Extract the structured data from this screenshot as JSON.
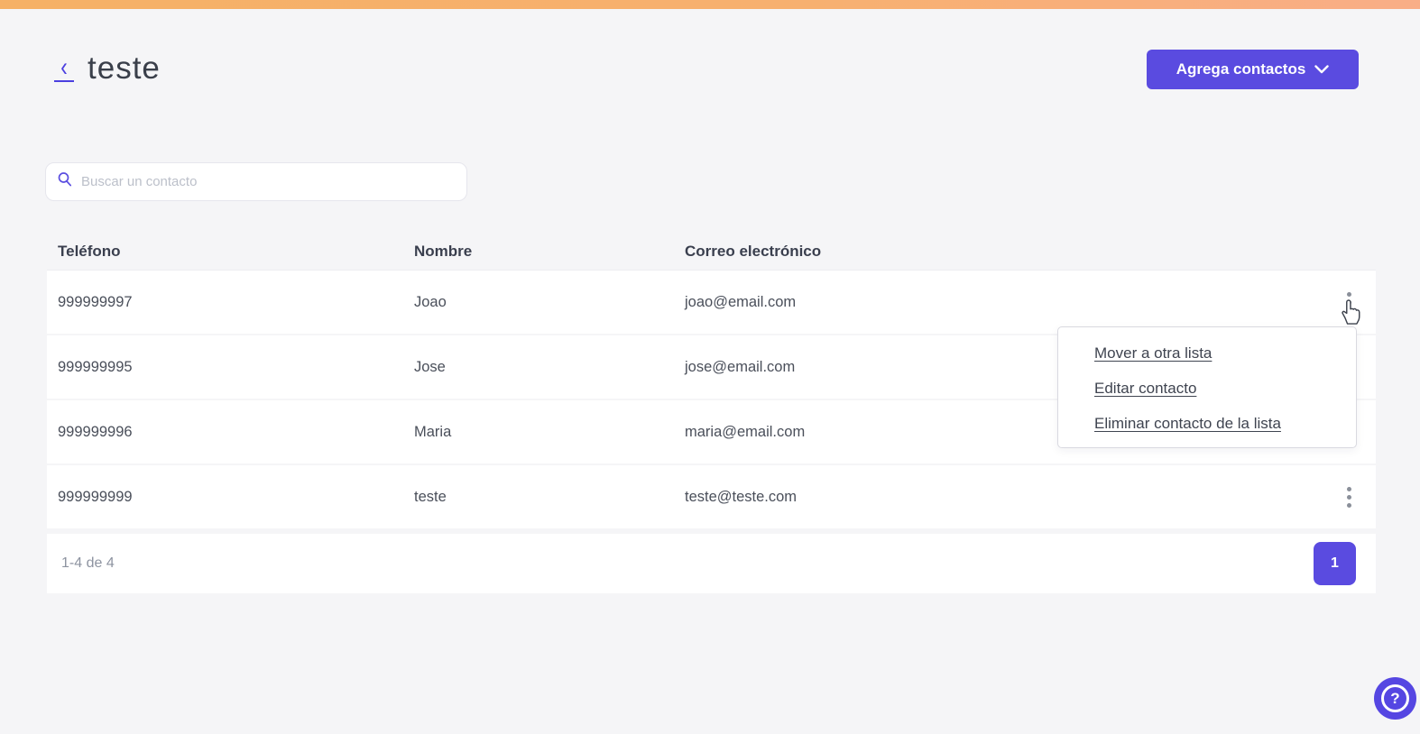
{
  "page": {
    "title": "teste"
  },
  "header": {
    "back_symbol": "‹",
    "add_contacts_button": {
      "label": "Agrega contactos"
    }
  },
  "search": {
    "placeholder": "Buscar un contacto"
  },
  "table": {
    "columns": [
      "Teléfono",
      "Nombre",
      "Correo electrónico"
    ],
    "rows": [
      {
        "phone": "999999997",
        "name": "Joao",
        "email": "joao@email.com"
      },
      {
        "phone": "999999995",
        "name": "Jose",
        "email": "jose@email.com"
      },
      {
        "phone": "999999996",
        "name": "Maria",
        "email": "maria@email.com"
      },
      {
        "phone": "999999999",
        "name": "teste",
        "email": "teste@teste.com"
      }
    ]
  },
  "context_menu": {
    "items": [
      {
        "label": "Mover a otra lista"
      },
      {
        "label": "Editar contacto"
      },
      {
        "label": "Eliminar contacto de la lista"
      }
    ]
  },
  "pagination": {
    "range_label": "1-4 de 4",
    "current_page": "1"
  },
  "help": {
    "label": "?"
  },
  "icons": {
    "search": "search-icon",
    "chevron_down": "chevron-down-icon",
    "kebab": "kebab-menu-icon",
    "help": "question-mark-icon",
    "cursor": "hand-cursor"
  },
  "colors": {
    "accent": "#5a4be0",
    "topbar_gradient_start": "#f6b166",
    "topbar_gradient_end": "#f9ae87",
    "background": "#f5f5f7",
    "text_dark": "#3a3f4e",
    "text_muted": "#8d93a0"
  }
}
